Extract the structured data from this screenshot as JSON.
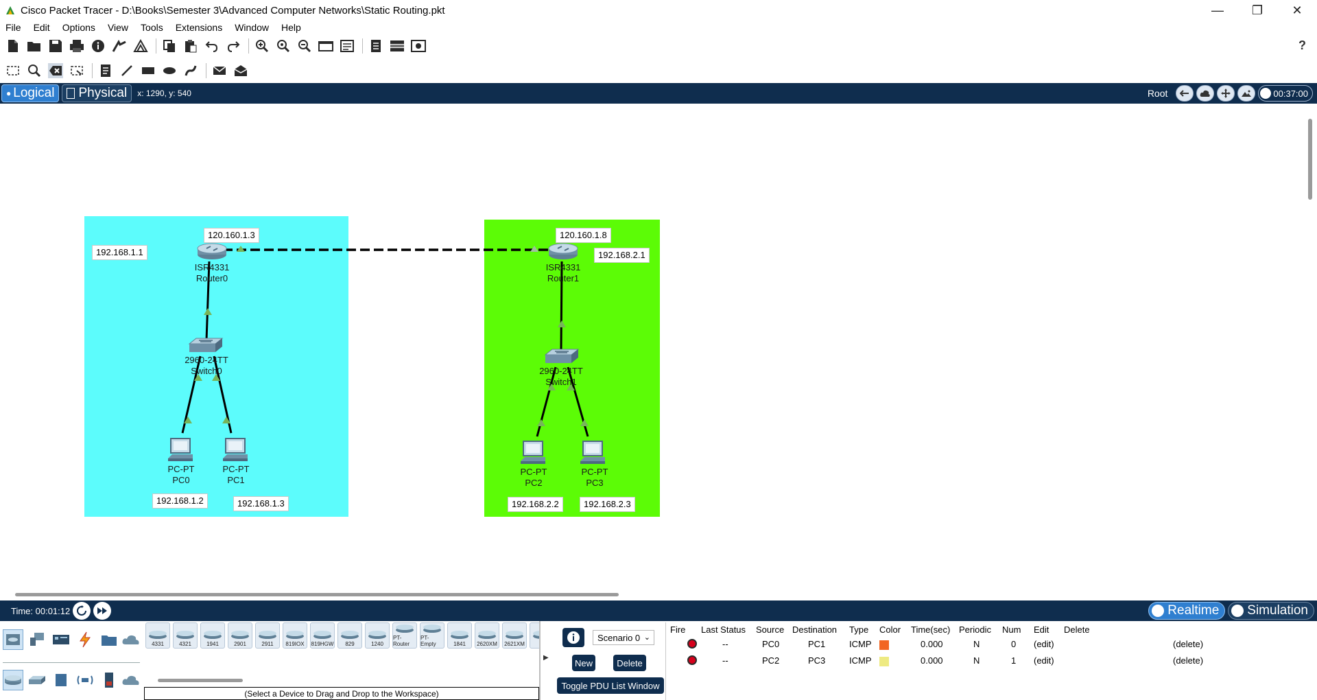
{
  "window": {
    "title": "Cisco Packet Tracer - D:\\Books\\Semester 3\\Advanced Computer Networks\\Static Routing.pkt",
    "controls": [
      "minimize-icon",
      "restore-icon",
      "close-icon"
    ]
  },
  "menu": [
    "File",
    "Edit",
    "Options",
    "View",
    "Tools",
    "Extensions",
    "Window",
    "Help"
  ],
  "toolbar1": {
    "icons": [
      "new-icon",
      "open-icon",
      "save-icon",
      "print-icon",
      "info-icon",
      "activity-wizard-icon",
      "network-info-icon",
      "copy-icon",
      "paste-icon",
      "undo-icon",
      "redo-icon",
      "zoom-in-icon",
      "zoom-reset-icon",
      "zoom-out-icon",
      "drawing-palette-icon",
      "custom-device-icon",
      "cluster-icon",
      "tree-view-icon",
      "pdu-view-icon"
    ],
    "help": "?"
  },
  "toolbar2": {
    "icons": [
      "select-icon",
      "inspect-icon",
      "delete-icon",
      "resize-icon",
      "place-note-icon",
      "draw-line-icon",
      "draw-rectangle-icon",
      "draw-ellipse-icon",
      "freeform-icon",
      "add-simple-pdu-icon",
      "add-complex-pdu-icon"
    ]
  },
  "workspace": {
    "tab_logical": "Logical",
    "tab_physical": "Physical",
    "coords": "x: 1290, y: 540",
    "root_label": "Root",
    "clock": "00:37:00"
  },
  "topology": {
    "devices": [
      {
        "id": "router0",
        "model": "ISR4331",
        "name": "Router0",
        "type": "router"
      },
      {
        "id": "router1",
        "model": "ISR4331",
        "name": "Router1",
        "type": "router"
      },
      {
        "id": "switch0",
        "model": "2960-24TT",
        "name": "Switch0",
        "type": "switch"
      },
      {
        "id": "switch1",
        "model": "2960-24TT",
        "name": "Switch1",
        "type": "switch"
      },
      {
        "id": "pc0",
        "model": "PC-PT",
        "name": "PC0",
        "type": "pc"
      },
      {
        "id": "pc1",
        "model": "PC-PT",
        "name": "PC1",
        "type": "pc"
      },
      {
        "id": "pc2",
        "model": "PC-PT",
        "name": "PC2",
        "type": "pc"
      },
      {
        "id": "pc3",
        "model": "PC-PT",
        "name": "PC3",
        "type": "pc"
      }
    ],
    "ip_labels": {
      "r0_wan": "120.160.1.3",
      "r0_lan": "192.168.1.1",
      "r1_wan": "120.160.1.8",
      "r1_lan": "192.168.2.1",
      "pc0": "192.168.1.2",
      "pc1": "192.168.1.3",
      "pc2": "192.168.2.2",
      "pc3": "192.168.2.3"
    },
    "area_colors": {
      "left": "#5cfcfc",
      "right": "#5cfc06"
    }
  },
  "status": {
    "time": "Time: 00:01:12",
    "realtime": "Realtime",
    "simulation": "Simulation"
  },
  "device_categories": [
    "network-devices-icon",
    "end-devices-icon",
    "components-icon",
    "connections-icon",
    "miscellaneous-icon",
    "multiuser-icon"
  ],
  "device_subcategories": [
    "routers-icon",
    "switches-icon",
    "hubs-icon",
    "wireless-icon",
    "security-icon",
    "wan-emulation-icon"
  ],
  "device_models": [
    "4331",
    "4321",
    "1941",
    "2901",
    "2911",
    "819IOX",
    "819HGW",
    "829",
    "1240",
    "PT-Router",
    "PT-Empty",
    "1841",
    "2620XM",
    "2621XM",
    "2"
  ],
  "device_hint": "(Select a Device to Drag and Drop to the Workspace)",
  "scenario": {
    "selected": "Scenario 0",
    "new": "New",
    "delete": "Delete",
    "toggle": "Toggle PDU List Window"
  },
  "pdu_table": {
    "headers": [
      "Fire",
      "Last Status",
      "Source",
      "Destination",
      "Type",
      "Color",
      "Time(sec)",
      "Periodic",
      "Num",
      "Edit",
      "Delete"
    ],
    "rows": [
      {
        "last_status": "--",
        "source": "PC0",
        "destination": "PC1",
        "type": "ICMP",
        "color": "#f26522",
        "time": "0.000",
        "periodic": "N",
        "num": "0",
        "edit": "(edit)",
        "delete": "(delete)"
      },
      {
        "last_status": "--",
        "source": "PC2",
        "destination": "PC3",
        "type": "ICMP",
        "color": "#eeea82",
        "time": "0.000",
        "periodic": "N",
        "num": "1",
        "edit": "(edit)",
        "delete": "(delete)"
      }
    ]
  }
}
